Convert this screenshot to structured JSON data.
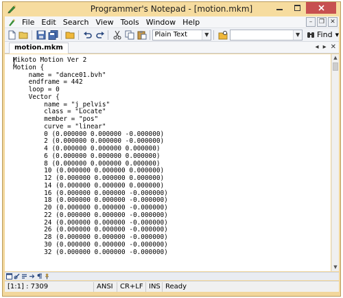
{
  "window": {
    "title": "Programmer's Notepad - [motion.mkm]",
    "controls": [
      "minimize",
      "maximize",
      "close"
    ]
  },
  "menu": {
    "items": [
      "File",
      "Edit",
      "Search",
      "View",
      "Tools",
      "Window",
      "Help"
    ],
    "mdi_controls": [
      "minimize",
      "restore",
      "close"
    ]
  },
  "toolbar": {
    "scheme_value": "Plain Text",
    "search_value": "",
    "find_label": "Find"
  },
  "tabs": {
    "active": "motion.mkm"
  },
  "editor": {
    "lines": [
      "Mikoto Motion Ver 2",
      "Motion {",
      "    name = \"dance01.bvh\"",
      "    endframe = 442",
      "    loop = 0",
      "    Vector {",
      "        name = \"j_pelvis\"",
      "        class = \"Locate\"",
      "        member = \"pos\"",
      "        curve = \"linear\"",
      "        0 (0.000000 0.000000 -0.000000)",
      "        2 (0.000000 0.000000 -0.000000)",
      "        4 (0.000000 0.000000 0.000000)",
      "        6 (0.000000 0.000000 0.000000)",
      "        8 (0.000000 0.000000 0.000000)",
      "        10 (0.000000 0.000000 0.000000)",
      "        12 (0.000000 0.000000 0.000000)",
      "        14 (0.000000 0.000000 0.000000)",
      "        16 (0.000000 0.000000 -0.000000)",
      "        18 (0.000000 0.000000 -0.000000)",
      "        20 (0.000000 0.000000 -0.000000)",
      "        22 (0.000000 0.000000 -0.000000)",
      "        24 (0.000000 0.000000 -0.000000)",
      "        26 (0.000000 0.000000 -0.000000)",
      "        28 (0.000000 0.000000 -0.000000)",
      "        30 (0.000000 0.000000 -0.000000)",
      "        32 (0.000000 0.000000 -0.000000)"
    ]
  },
  "status": {
    "position": "[1:1] : 7309",
    "encoding": "ANSI",
    "line_endings": "CR+LF",
    "insert_mode": "INS",
    "state": "Ready"
  },
  "colors": {
    "title_bar": "#f6dc9f",
    "close_button": "#c75050"
  }
}
